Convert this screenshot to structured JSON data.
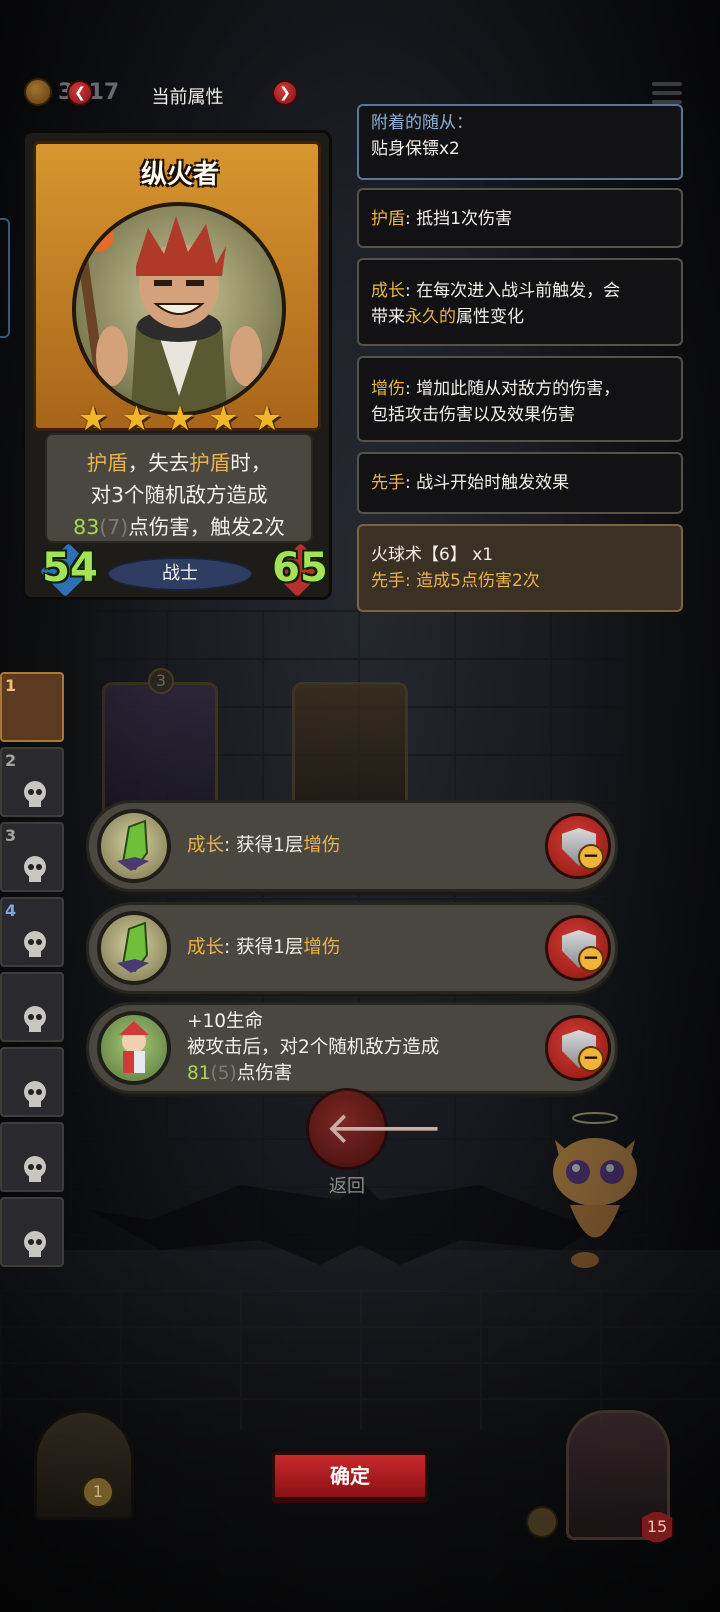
{
  "topbar": {
    "coin_count": "3517",
    "title": "当前属性",
    "prev_glyph": "❮",
    "next_glyph": "❯"
  },
  "hero_card": {
    "name": "纵火者",
    "stars": 5,
    "desc_line1_a": "护盾",
    "desc_line1_b": "，失去",
    "desc_line1_c": "护盾",
    "desc_line1_d": "时，",
    "desc_line2": "对3个随机敌方造成",
    "desc_line3_value": "83",
    "desc_line3_base": "(7)",
    "desc_line3_rest": "点伤害，触发2次",
    "attack": "54",
    "health": "65",
    "class_label": "战士"
  },
  "panels": {
    "attached_label": "附着的随从：",
    "attached_value": "贴身保镖x2",
    "shield_kw": "护盾",
    "shield_text": ": 抵挡1次伤害",
    "growth_kw": "成长",
    "growth_text1": ": 在每次进入战斗前触发，会",
    "growth_text2a": "带来",
    "growth_text2b": "永久的",
    "growth_text2c": "属性变化",
    "dmg_kw": "增伤",
    "dmg_text1": ": 增加此随从对敌方的伤害，",
    "dmg_text2": "包括攻击伤害以及效果伤害",
    "first_kw": "先手",
    "first_text": ": 战斗开始时触发效果",
    "spell_title": "火球术【6】 x1",
    "spell_kw": "先手",
    "spell_text": ": 造成5点伤害2次"
  },
  "team": {
    "slots": [
      "1",
      "2",
      "3",
      "4",
      "",
      "",
      "",
      ""
    ]
  },
  "background": {
    "minion_level": "3"
  },
  "buffs": [
    {
      "title": "成长",
      "sep": ": 获得1层",
      "kw": "增伤",
      "icon": "green-crystal-icon"
    },
    {
      "title": "成长",
      "sep": ": 获得1层",
      "kw": "增伤",
      "icon": "green-crystal-icon"
    },
    {
      "line1": "+10生命",
      "line2": "被攻击后，对2个随机敌方造成",
      "value": "81",
      "base": "(5)",
      "rest": "点伤害",
      "icon": "jester-minion-icon"
    }
  ],
  "back": {
    "label": "返回",
    "glyph": "🡐"
  },
  "bottom": {
    "confirm_label": "确定",
    "gate_count": "1",
    "hero_level": "15"
  },
  "colors": {
    "keyword_gold": "#eab24a",
    "value_green": "#a6d84c",
    "confirm_red": "#c8292b"
  }
}
